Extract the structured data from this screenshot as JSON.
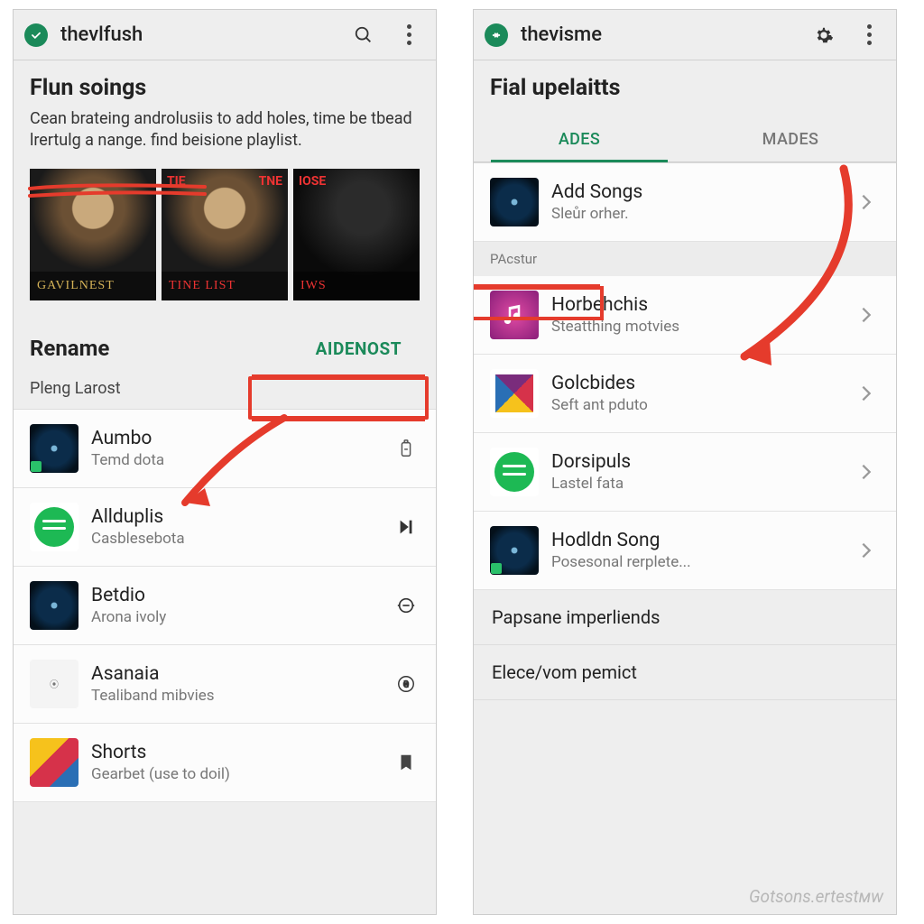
{
  "left": {
    "header": {
      "title": "thevlfush"
    },
    "intro": {
      "heading": "Flun soings",
      "body": "Cean brateing androlusiis to add holes, time be tbead lrertulg a nange. find beisione playlist."
    },
    "thumbs": [
      {
        "label": "GAVILNEST",
        "top": "",
        "rt": ""
      },
      {
        "label": "TINE LIST",
        "top": "TIE",
        "rt": "TNE"
      },
      {
        "label": "IWS",
        "top": "IOSE",
        "rt": ""
      }
    ],
    "rename": {
      "heading": "Rename",
      "button": "AIDENOST",
      "subhead": "Pleng Larost"
    },
    "rows": [
      {
        "title": "Aumbo",
        "sub": "Temd dota",
        "art": "disc",
        "end": "battery"
      },
      {
        "title": "Allduplis",
        "sub": "Casblesebota",
        "art": "spotify-green",
        "end": "skip"
      },
      {
        "title": "Betdio",
        "sub": "Arona ivoly",
        "art": "disc",
        "end": "minus"
      },
      {
        "title": "Asanaia",
        "sub": "Tealiband mibvies",
        "art": "outline",
        "end": "coin"
      },
      {
        "title": "Shorts",
        "sub": "Gearbet (use to doil)",
        "art": "colorblock",
        "end": "bookmark"
      }
    ]
  },
  "right": {
    "header": {
      "title": "thevisme"
    },
    "intro": {
      "heading": "Fial upelaitts"
    },
    "tabs": {
      "active": "ADES",
      "other": "MADES"
    },
    "sectionLabel": "PAcstur",
    "rows": [
      {
        "title": "Add Songs",
        "sub": "Sleůr orher.",
        "art": "disc"
      },
      {
        "title": "Horbehchis",
        "sub": "Steatthing motvies",
        "art": "music"
      },
      {
        "title": "Golcbides",
        "sub": "Seft ant pduto",
        "art": "geometric"
      },
      {
        "title": "Dorsipuls",
        "sub": "Lastel fata",
        "art": "spotify-green"
      },
      {
        "title": "Hodldn Song",
        "sub": "Posesonal rerplete...",
        "art": "disc"
      }
    ],
    "footer": [
      "Papsane imperliends",
      "Elece/vom pemict"
    ],
    "watermark": "Gotsons.ertestмw"
  }
}
